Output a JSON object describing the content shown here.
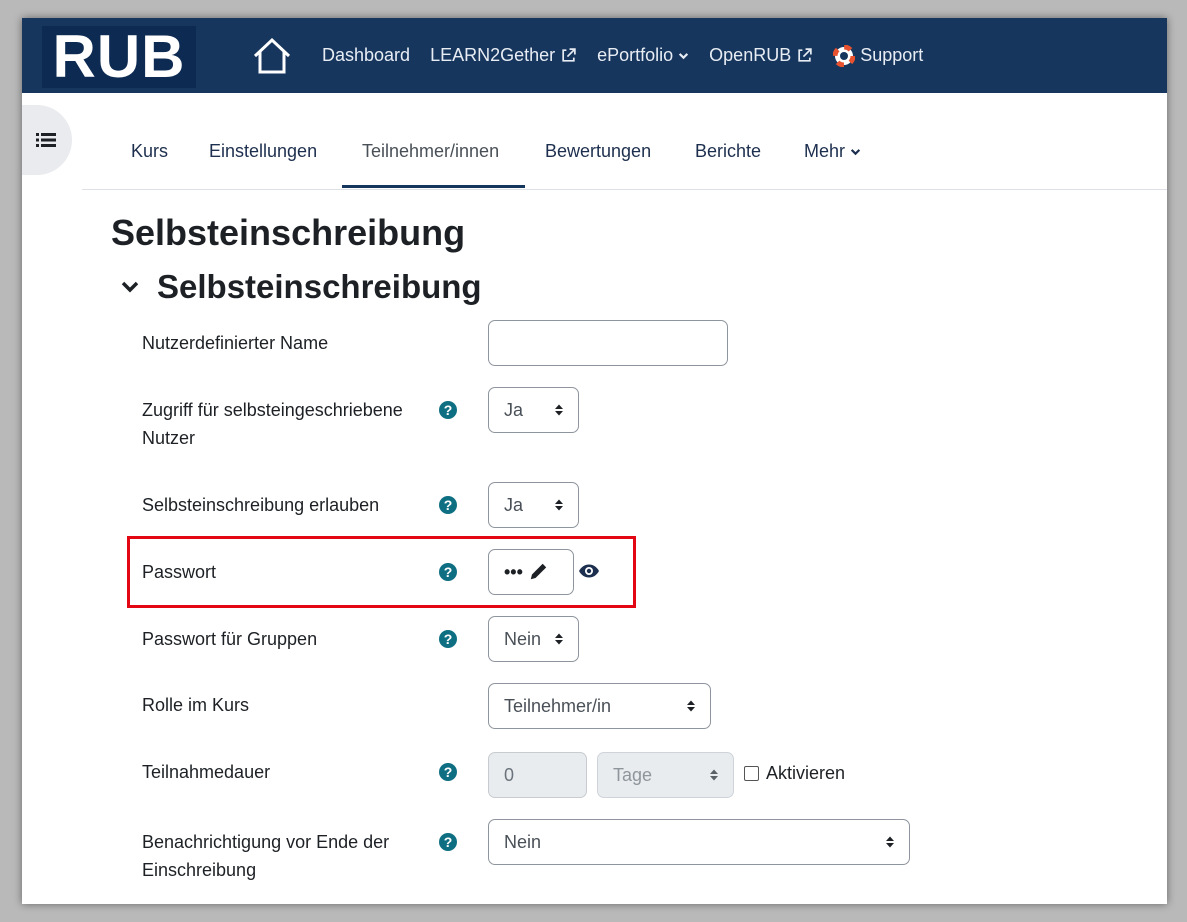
{
  "navbar": {
    "logo_text": "RUB",
    "links": [
      {
        "label": "Dashboard",
        "icon": ""
      },
      {
        "label": "LEARN2Gether",
        "icon": "external-link-icon"
      },
      {
        "label": "ePortfolio",
        "icon": "chevron-down-icon"
      },
      {
        "label": "OpenRUB",
        "icon": "external-link-icon"
      },
      {
        "label": "Support",
        "icon": "lifebuoy-icon"
      }
    ]
  },
  "tabs": [
    "Kurs",
    "Einstellungen",
    "Teilnehmer/innen",
    "Bewertungen",
    "Berichte",
    "Mehr"
  ],
  "page_title": "Selbsteinschreibung",
  "section_title": "Selbsteinschreibung",
  "form": {
    "custom_name": {
      "label": "Nutzerdefinierter Name",
      "value": ""
    },
    "access": {
      "label": "Zugriff für selbsteingeschriebene Nutzer",
      "value": "Ja"
    },
    "allow": {
      "label": "Selbsteinschreibung erlauben",
      "value": "Ja"
    },
    "password": {
      "label": "Passwort",
      "value": "•••"
    },
    "group_password": {
      "label": "Passwort für Gruppen",
      "value": "Nein"
    },
    "role": {
      "label": "Rolle im Kurs",
      "value": "Teilnehmer/in"
    },
    "duration": {
      "label": "Teilnahmedauer",
      "value": "0",
      "unit": "Tage",
      "enable_label": "Aktivieren"
    },
    "notify": {
      "label": "Benachrichtigung vor Ende der Einschreibung",
      "value": "Nein"
    }
  },
  "colors": {
    "navbar": "#17365d",
    "help_icon": "#0f6f82",
    "highlight": "#e30613"
  }
}
